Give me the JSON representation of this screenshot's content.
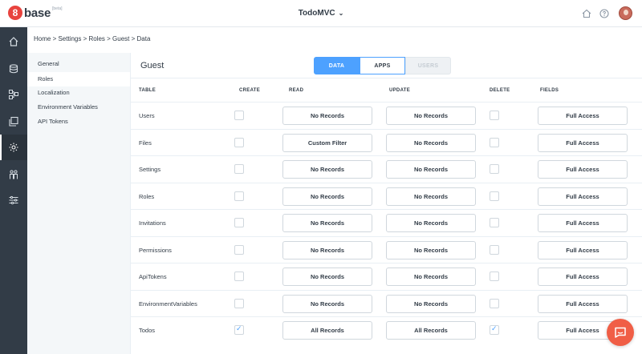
{
  "logo": {
    "badge": "8",
    "text": "base",
    "beta": "[beta]"
  },
  "app": {
    "title": "TodoMVC",
    "dropdown_icon": "chevron-down-icon"
  },
  "header_icons": [
    "home-icon",
    "help-icon",
    "user-avatar"
  ],
  "left_nav": [
    "home-icon",
    "database-icon",
    "sitemap-icon",
    "layers-icon",
    "settings-gear-icon",
    "team-icon",
    "sliders-icon"
  ],
  "breadcrumb": "Home  >  Settings  >  Roles  >  Guest  >  Data",
  "settings_nav": [
    "General",
    "Roles",
    "Localization",
    "Environment Variables",
    "API Tokens"
  ],
  "role_title": "Guest",
  "tabs": {
    "data": "DATA",
    "apps": "APPS",
    "users": "USERS"
  },
  "columns": {
    "table": "TABLE",
    "create": "CREATE",
    "read": "READ",
    "update": "UPDATE",
    "delete": "DELETE",
    "fields": "FIELDS"
  },
  "rows": [
    {
      "name": "Users",
      "create": false,
      "read": "No Records",
      "update": "No Records",
      "delete": false,
      "fields": "Full Access"
    },
    {
      "name": "Files",
      "create": false,
      "read": "Custom Filter",
      "update": "No Records",
      "delete": false,
      "fields": "Full Access"
    },
    {
      "name": "Settings",
      "create": false,
      "read": "No Records",
      "update": "No Records",
      "delete": false,
      "fields": "Full Access"
    },
    {
      "name": "Roles",
      "create": false,
      "read": "No Records",
      "update": "No Records",
      "delete": false,
      "fields": "Full Access"
    },
    {
      "name": "Invitations",
      "create": false,
      "read": "No Records",
      "update": "No Records",
      "delete": false,
      "fields": "Full Access"
    },
    {
      "name": "Permissions",
      "create": false,
      "read": "No Records",
      "update": "No Records",
      "delete": false,
      "fields": "Full Access"
    },
    {
      "name": "ApiTokens",
      "create": false,
      "read": "No Records",
      "update": "No Records",
      "delete": false,
      "fields": "Full Access"
    },
    {
      "name": "EnvironmentVariables",
      "create": false,
      "read": "No Records",
      "update": "No Records",
      "delete": false,
      "fields": "Full Access"
    },
    {
      "name": "Todos",
      "create": true,
      "read": "All Records",
      "update": "All Records",
      "delete": true,
      "fields": "Full Access"
    }
  ],
  "colors": {
    "primary": "#4da1ff",
    "sidebar": "#323c47",
    "chat": "#f05e46",
    "logo": "#e8433e"
  }
}
